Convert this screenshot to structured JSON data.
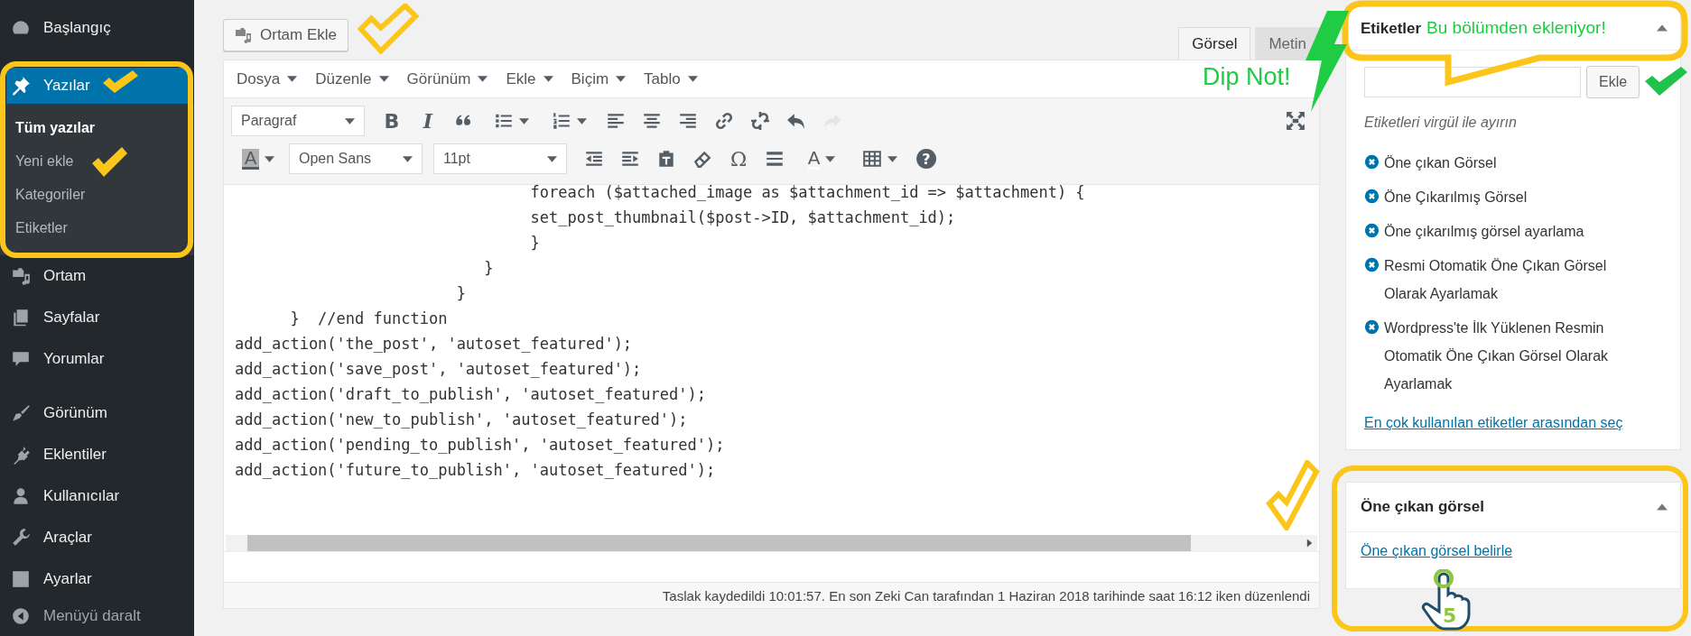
{
  "sidebar": {
    "groups": [
      {
        "items": [
          {
            "label": "Başlangıç",
            "selected": false
          }
        ]
      },
      {
        "items": [
          {
            "label": "Yazılar",
            "selected": true,
            "children": [
              {
                "label": "Tüm yazılar",
                "selected": true
              },
              {
                "label": "Yeni ekle",
                "selected": false
              },
              {
                "label": "Kategoriler",
                "selected": false
              },
              {
                "label": "Etiketler",
                "selected": false
              }
            ]
          },
          {
            "label": "Ortam",
            "selected": false
          },
          {
            "label": "Sayfalar",
            "selected": false
          },
          {
            "label": "Yorumlar",
            "selected": false
          }
        ]
      },
      {
        "items": [
          {
            "label": "Görünüm",
            "selected": false
          },
          {
            "label": "Eklentiler",
            "selected": false
          },
          {
            "label": "Kullanıcılar",
            "selected": false
          },
          {
            "label": "Araçlar",
            "selected": false
          },
          {
            "label": "Ayarlar",
            "selected": false
          }
        ]
      }
    ],
    "collapse": "Menüyü daralt"
  },
  "media_button": "Ortam Ekle",
  "editor_tabs": [
    {
      "label": "Görsel",
      "selected": true
    },
    {
      "label": "Metin",
      "selected": false
    }
  ],
  "menubar": [
    "Dosya",
    "Düzenle",
    "Görünüm",
    "Ekle",
    "Biçim",
    "Tablo"
  ],
  "toolbar": {
    "rows": [
      {
        "items": [
          {
            "kind": "select",
            "label": "Paragraf",
            "disabled": false
          },
          {
            "kind": "bold",
            "label": "B",
            "disabled": false
          },
          {
            "kind": "italic",
            "label": "I",
            "disabled": false
          },
          {
            "kind": "blockquote",
            "disabled": false
          },
          {
            "kind": "bullist",
            "disabled": false
          },
          {
            "kind": "numlist",
            "disabled": false
          },
          {
            "kind": "alignleft",
            "disabled": false
          },
          {
            "kind": "aligncenter",
            "disabled": false
          },
          {
            "kind": "alignright",
            "disabled": false
          },
          {
            "kind": "link",
            "disabled": false
          },
          {
            "kind": "unlink",
            "disabled": false
          },
          {
            "kind": "undo",
            "disabled": false
          },
          {
            "kind": "redo",
            "disabled": true
          }
        ]
      },
      {
        "items": [
          {
            "kind": "backcolor",
            "label": "A",
            "disabled": false
          },
          {
            "kind": "select",
            "label": "Open Sans",
            "disabled": false
          },
          {
            "kind": "select",
            "label": "11pt",
            "disabled": false
          },
          {
            "kind": "outdent",
            "disabled": false
          },
          {
            "kind": "indent",
            "disabled": false
          },
          {
            "kind": "pastetext",
            "disabled": false
          },
          {
            "kind": "removeformat",
            "disabled": false
          },
          {
            "kind": "charmap",
            "label": "Ω",
            "disabled": false
          },
          {
            "kind": "hr",
            "disabled": false
          },
          {
            "kind": "forecolor",
            "label": "A",
            "disabled": false
          },
          {
            "kind": "table",
            "disabled": false
          },
          {
            "kind": "help",
            "label": "?",
            "disabled": false
          }
        ]
      }
    ]
  },
  "code_lines": [
    "                                foreach ($attached_image as $attachment_id => $attachment) {",
    "                                set_post_thumbnail($post->ID, $attachment_id);",
    "                                }",
    "                           }",
    "                        }",
    "      }  //end function",
    "add_action('the_post', 'autoset_featured');",
    "add_action('save_post', 'autoset_featured');",
    "add_action('draft_to_publish', 'autoset_featured');",
    "add_action('new_to_publish', 'autoset_featured');",
    "add_action('pending_to_publish', 'autoset_featured');",
    "add_action('future_to_publish', 'autoset_featured');"
  ],
  "status_bar": "Taslak kaydedildi 10:01:57. En son Zeki Can tarafından 1 Haziran 2018 tarihinde saat 16:12 iken düzenlendi",
  "tags_box": {
    "title": "Etiketler",
    "add_button": "Ekle",
    "hint": "Etiketleri virgül ile ayırın",
    "tags": [
      "Öne çıkan Görsel",
      "Öne Çıkarılmış Görsel",
      "Öne çıkarılmış görsel ayarlama",
      "Resmi Otomatik Öne Çıkan Görsel Olarak Ayarlamak",
      "Wordpress'te İlk Yüklenen Resmin Otomatik Öne Çıkan Görsel Olarak Ayarlamak"
    ],
    "link": "En çok kullanılan etiketler arasından seç"
  },
  "featured_box": {
    "title": "Öne çıkan görsel",
    "link": "Öne çıkan görsel belirle"
  },
  "annotations": {
    "tags_note": "Bu bölümden ekleniyor!",
    "tip": "Dip Not!",
    "step": "5"
  }
}
